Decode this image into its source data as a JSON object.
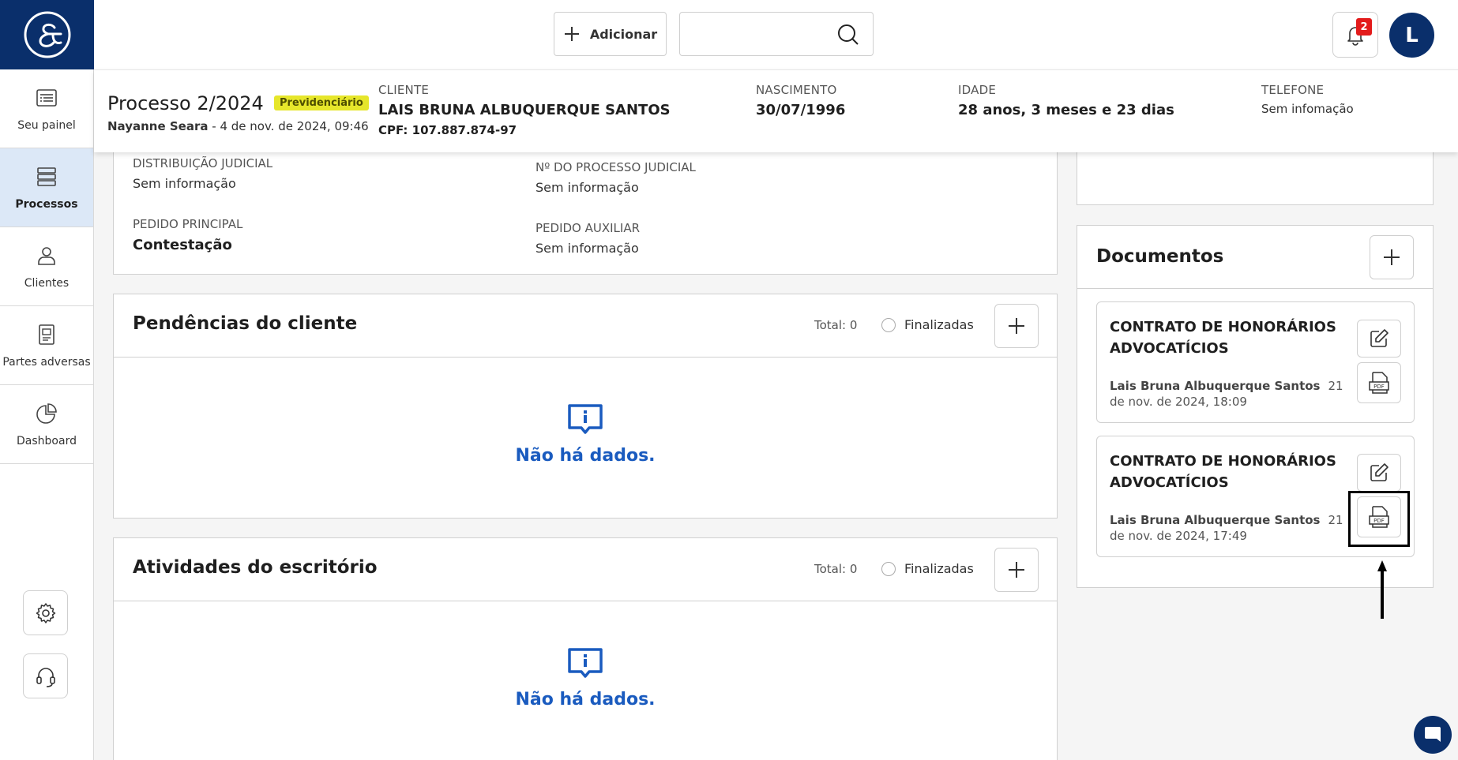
{
  "sidebar": {
    "logo": "&-logo",
    "items": [
      {
        "label": "Seu painel",
        "icon": "dashboard-list-icon",
        "active": false
      },
      {
        "label": "Processos",
        "icon": "stack-icon",
        "active": true
      },
      {
        "label": "Clientes",
        "icon": "user-icon",
        "active": false
      },
      {
        "label": "Partes adversas",
        "icon": "document-person-icon",
        "active": false
      },
      {
        "label": "Dashboard",
        "icon": "pie-chart-icon",
        "active": false
      }
    ]
  },
  "topbar": {
    "add_label": "Adicionar",
    "search_placeholder": "",
    "notifications_count": "2",
    "avatar_letter": "L"
  },
  "process": {
    "title": "Processo 2/2024",
    "badge": "Previdenciário",
    "author": "Nayanne Seara",
    "date": " - 4 de nov. de 2024, 09:46",
    "client_label": "CLIENTE",
    "client_name": "LAIS BRUNA ALBUQUERQUE SANTOS",
    "client_cpf": "CPF: 107.887.874-97",
    "birth_label": "NASCIMENTO",
    "birth_value": "30/07/1996",
    "age_label": "IDADE",
    "age_value": "28 anos, 3 meses e 23 dias",
    "phone_label": "TELEFONE",
    "phone_value": "Sem infomação"
  },
  "details": {
    "distribution_label": "DISTRIBUIÇÃO JUDICIAL",
    "distribution_value": "Sem informação",
    "process_number_label": "Nº DO PROCESSO JUDICIAL",
    "process_number_value": "Sem informação",
    "main_request_label": "PEDIDO PRINCIPAL",
    "main_request_value": "Contestação",
    "aux_request_label": "PEDIDO AUXILIAR",
    "aux_request_value": "Sem informação"
  },
  "pendencias": {
    "title": "Pendências do cliente",
    "total": "Total: 0",
    "finalized_label": "Finalizadas",
    "empty_text": "Não há dados."
  },
  "atividades": {
    "title": "Atividades do escritório",
    "total": "Total: 0",
    "finalized_label": "Finalizadas",
    "empty_text": "Não há dados."
  },
  "documentos": {
    "title": "Documentos",
    "items": [
      {
        "title": "CONTRATO DE HONORÁRIOS ADVOCATÍCIOS",
        "author": "Lais Bruna Albuquerque Santos",
        "date": "21 de nov. de 2024, 18:09"
      },
      {
        "title": "CONTRATO DE HONORÁRIOS ADVOCATÍCIOS",
        "author": "Lais Bruna Albuquerque Santos",
        "date": "21 de nov. de 2024, 17:49"
      }
    ]
  },
  "colors": {
    "brand": "#0a2f6b",
    "accent": "#1a5bbf",
    "active_nav": "#dce8f7",
    "badge": "#e6e62b",
    "alert": "#e31b1b"
  }
}
